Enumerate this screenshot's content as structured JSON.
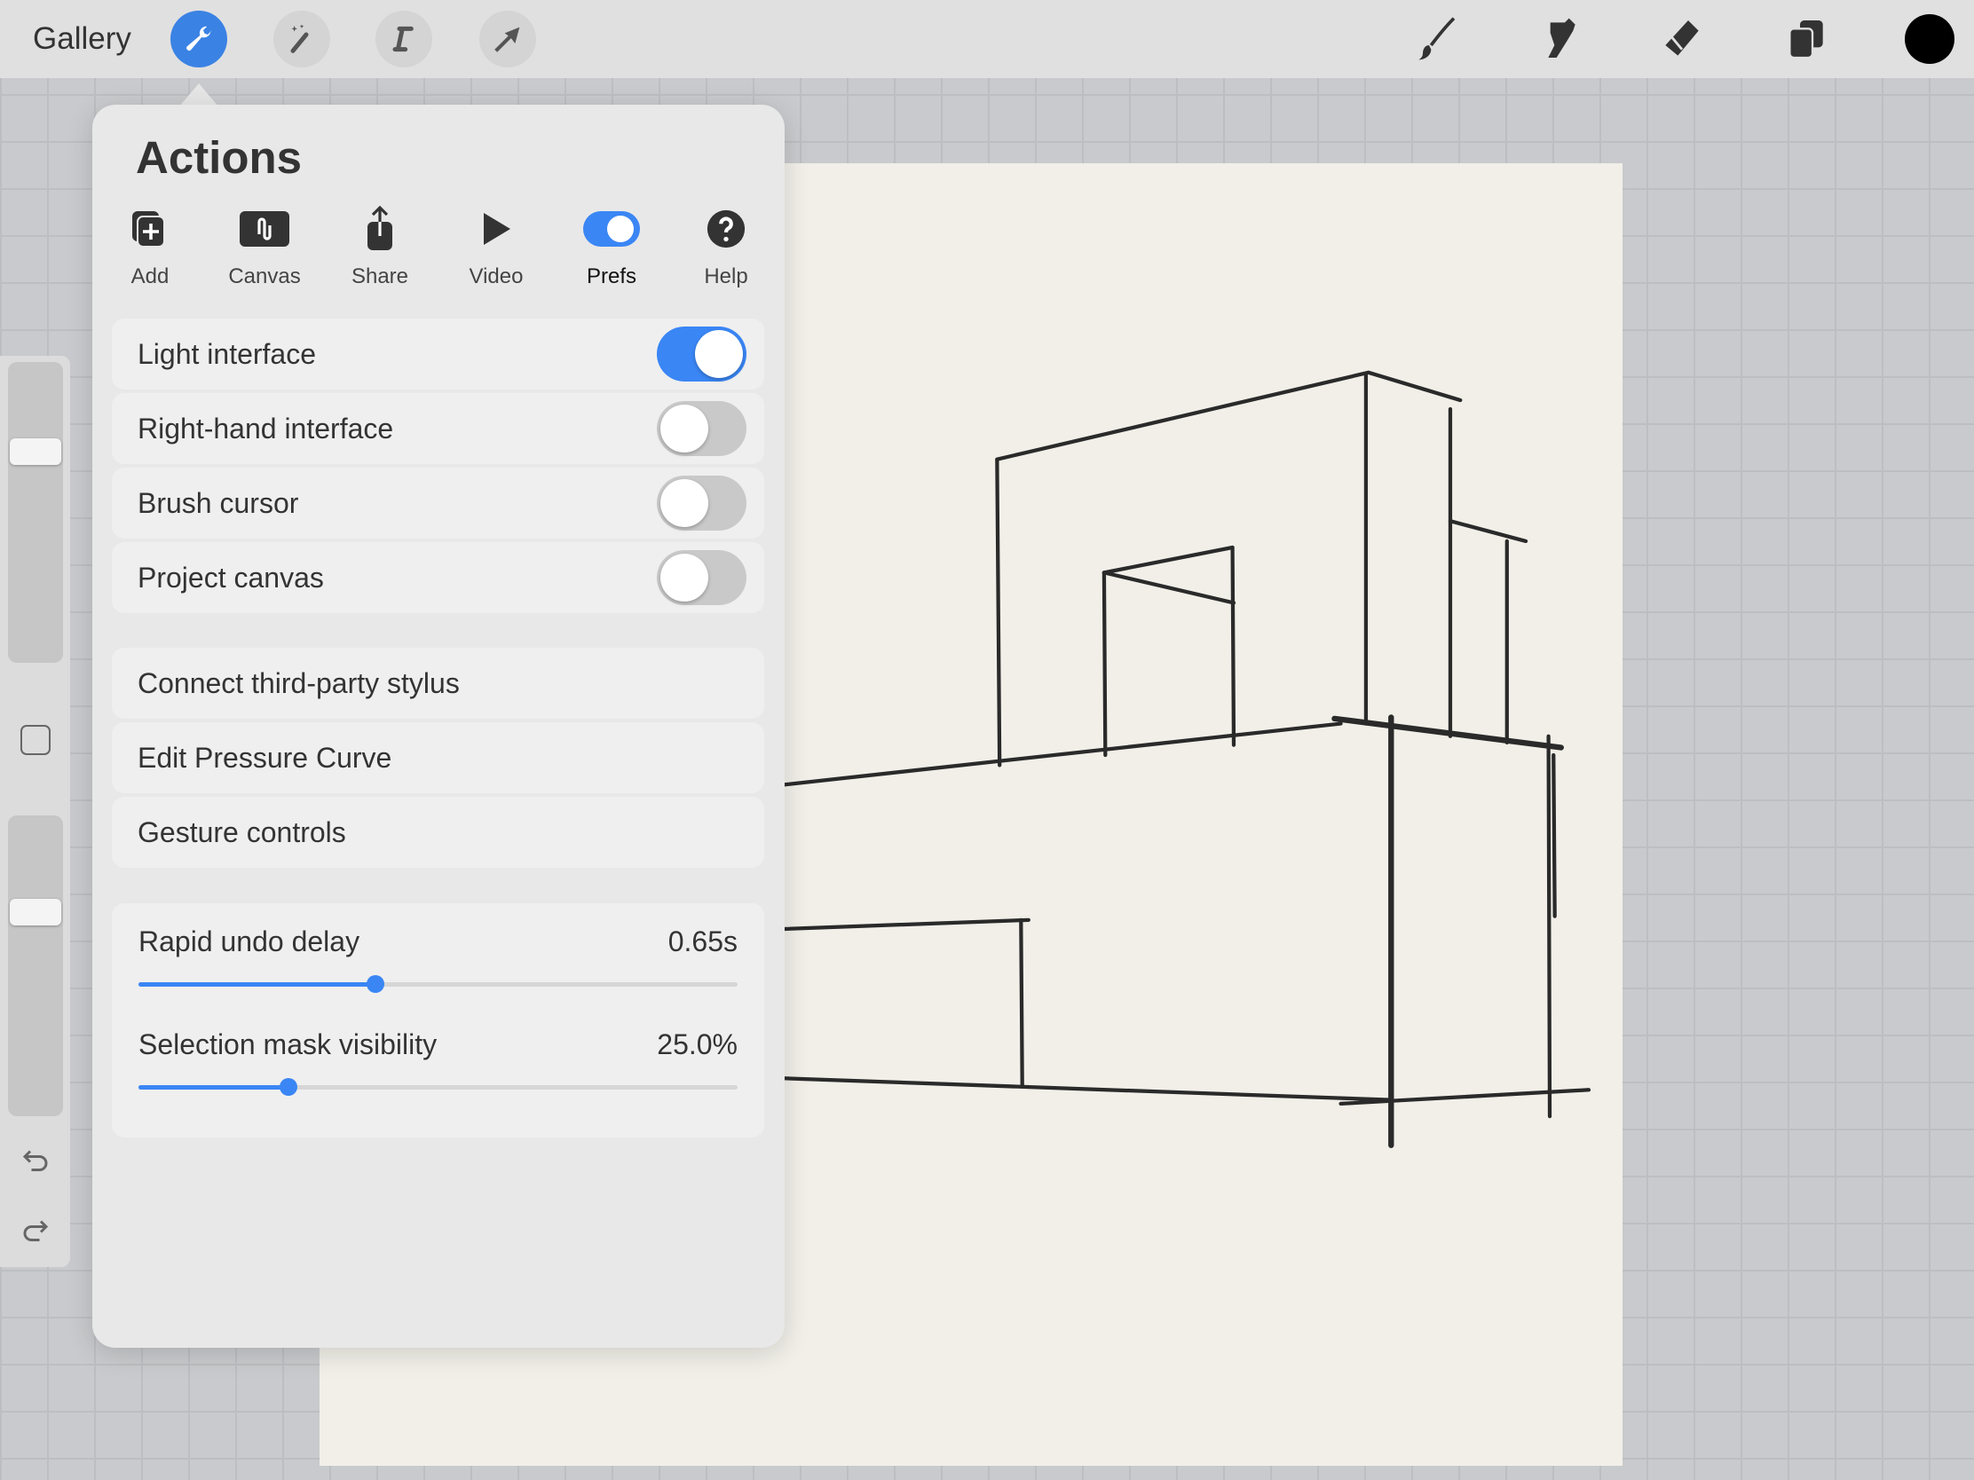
{
  "topbar": {
    "gallery": "Gallery",
    "tools_left": [
      "wrench-icon",
      "magic-wand-icon",
      "selection-s-icon",
      "arrow-transform-icon"
    ],
    "tools_right": [
      "brush-icon",
      "smudge-icon",
      "eraser-icon",
      "layers-icon",
      "color-swatch"
    ],
    "color": "#000000",
    "accent": "#3a82e4"
  },
  "panel": {
    "title": "Actions",
    "tabs": [
      {
        "label": "Add",
        "icon": "add-icon"
      },
      {
        "label": "Canvas",
        "icon": "canvas-icon"
      },
      {
        "label": "Share",
        "icon": "share-icon"
      },
      {
        "label": "Video",
        "icon": "play-icon"
      },
      {
        "label": "Prefs",
        "icon": "toggle-icon",
        "selected": true
      },
      {
        "label": "Help",
        "icon": "help-icon"
      }
    ],
    "toggles": [
      {
        "label": "Light interface",
        "on": true
      },
      {
        "label": "Right-hand interface",
        "on": false
      },
      {
        "label": "Brush cursor",
        "on": false
      },
      {
        "label": "Project canvas",
        "on": false
      }
    ],
    "links": [
      {
        "label": "Connect third-party stylus"
      },
      {
        "label": "Edit Pressure Curve"
      },
      {
        "label": "Gesture controls"
      }
    ],
    "sliders": [
      {
        "label": "Rapid undo delay",
        "value": "0.65s",
        "fraction": 0.395
      },
      {
        "label": "Selection mask visibility",
        "value": "25.0%",
        "fraction": 0.25
      }
    ]
  },
  "sidebar": {
    "brush_size_fraction": 0.7,
    "opacity_fraction": 0.68
  }
}
